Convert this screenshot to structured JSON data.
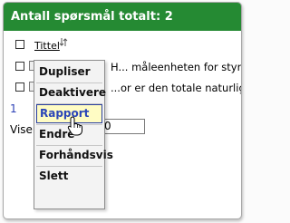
{
  "header": {
    "title": "Antall spørsmål totalt: 2"
  },
  "table": {
    "column_title": "Tittel",
    "rows": [
      {
        "text": "H... måleenheten for styrken p"
      },
      {
        "text": "...or er den totale naturlige s"
      }
    ]
  },
  "pager": {
    "page": "1"
  },
  "show": {
    "label": "Viser",
    "value": "0"
  },
  "context_menu": {
    "items": [
      {
        "label": "Dupliser"
      },
      {
        "label": "Deaktivere"
      },
      {
        "label": "Rapport"
      },
      {
        "label": "Endre"
      },
      {
        "label": "Forhåndsvis"
      },
      {
        "label": "Slett"
      }
    ],
    "active_index": 2
  },
  "colors": {
    "header_green": "#258a33",
    "menu_highlight": "#fffcc4",
    "highlight_text": "#2b45b8"
  },
  "icons": {
    "sort": "sort-arrows-icon",
    "cursor": "hand-pointer-icon"
  }
}
